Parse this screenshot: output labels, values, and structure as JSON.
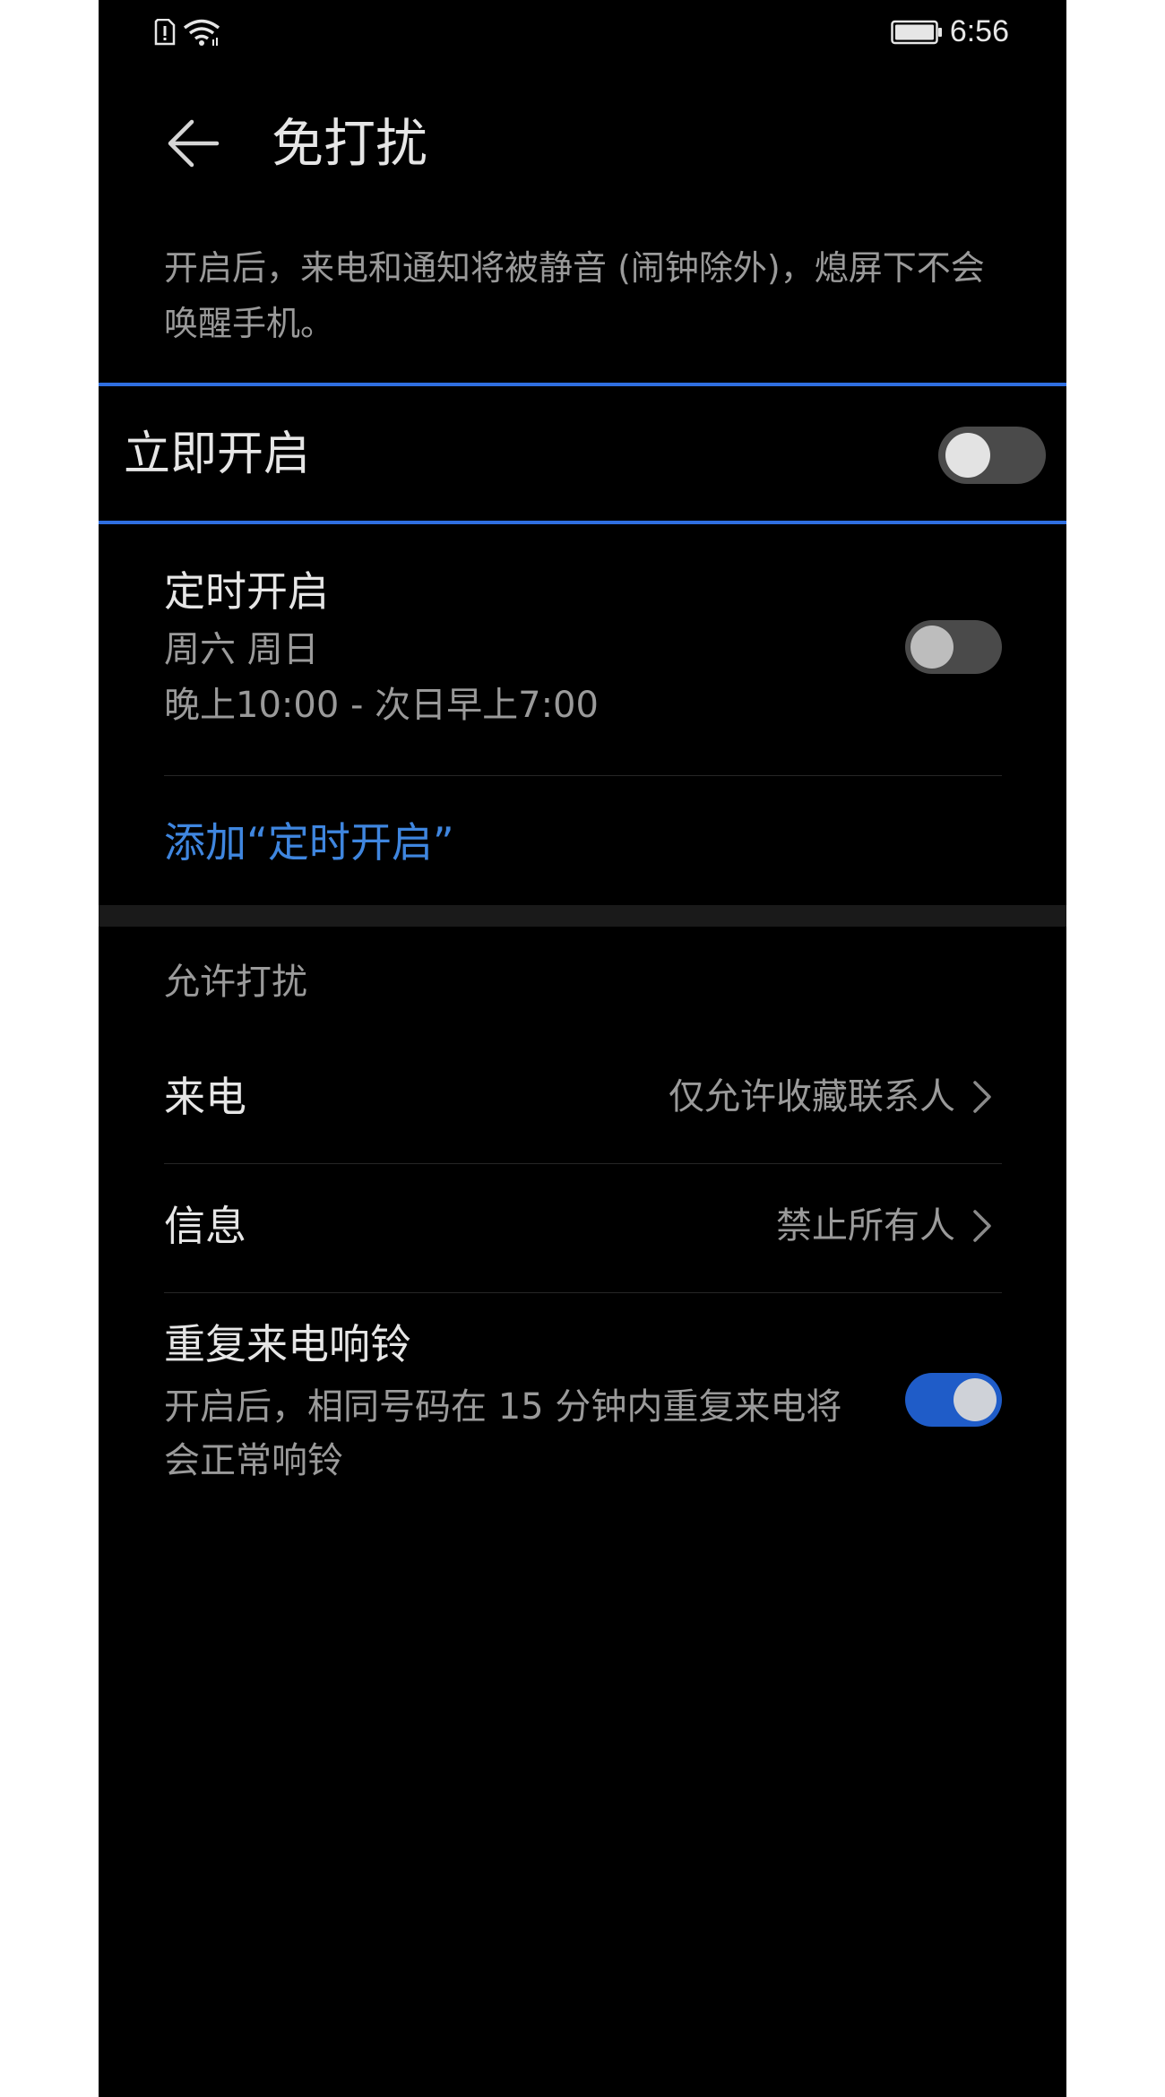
{
  "status_bar": {
    "time": "6:56",
    "icons": [
      "sim-alert-icon",
      "wifi-icon",
      "battery-icon"
    ]
  },
  "header": {
    "title": "免打扰",
    "back_icon": "arrow-left-icon"
  },
  "description": "开启后，来电和通知将被静音 (闹钟除外)，熄屏下不会唤醒手机。",
  "immediate": {
    "label": "立即开启",
    "enabled": false
  },
  "schedule": {
    "title": "定时开启",
    "days": "周六 周日",
    "time_range": "晚上10:00 - 次日早上7:00",
    "enabled": false
  },
  "add_schedule_label": "添加“定时开启”",
  "allow_section": {
    "title": "允许打扰",
    "items": [
      {
        "label": "来电",
        "value": "仅允许收藏联系人"
      },
      {
        "label": "信息",
        "value": "禁止所有人"
      }
    ]
  },
  "repeat_call": {
    "title": "重复来电响铃",
    "description": "开启后，相同号码在 15 分钟内重复来电将会正常响铃",
    "enabled": true
  },
  "colors": {
    "accent": "#3f86df",
    "toggle_on": "#1f5cc8",
    "highlight_border": "#2f6fe0"
  }
}
